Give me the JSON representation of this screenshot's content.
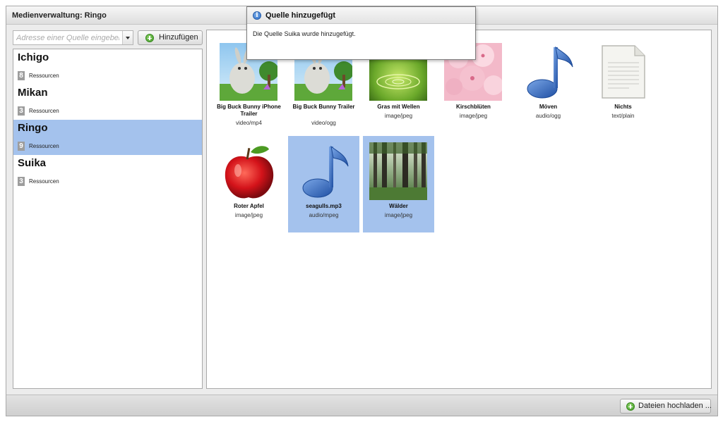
{
  "window": {
    "title": "Medienverwaltung: Ringo"
  },
  "source_input": {
    "placeholder": "Adresse einer Quelle eingeben",
    "value": ""
  },
  "add_button": {
    "label": "Hinzufügen"
  },
  "sources": [
    {
      "name": "Ichigo",
      "count": "8",
      "count_label": "Ressourcen",
      "selected": false
    },
    {
      "name": "Mikan",
      "count": "3",
      "count_label": "Ressourcen",
      "selected": false
    },
    {
      "name": "Ringo",
      "count": "9",
      "count_label": "Ressourcen",
      "selected": true
    },
    {
      "name": "Suika",
      "count": "3",
      "count_label": "Ressourcen",
      "selected": false
    }
  ],
  "media": [
    {
      "name": "Big Buck Bunny iPhone Trailer",
      "type": "video/mp4",
      "icon": "bunny-thumbnail",
      "selected": false
    },
    {
      "name": "Big Buck Bunny Trailer",
      "type": "video/ogg",
      "icon": "bunny-thumbnail",
      "selected": false
    },
    {
      "name": "Gras mit Wellen",
      "type": "image/jpeg",
      "icon": "grass-thumbnail",
      "selected": false
    },
    {
      "name": "Kirschblüten",
      "type": "image/jpeg",
      "icon": "blossom-thumbnail",
      "selected": false
    },
    {
      "name": "Möven",
      "type": "audio/ogg",
      "icon": "music-note-icon",
      "selected": false
    },
    {
      "name": "Nichts",
      "type": "text/plain",
      "icon": "document-icon",
      "selected": false
    },
    {
      "name": "Roter Apfel",
      "type": "image/jpeg",
      "icon": "apple-thumbnail",
      "selected": false
    },
    {
      "name": "seagulls.mp3",
      "type": "audio/mpeg",
      "icon": "music-note-icon",
      "selected": true
    },
    {
      "name": "Wälder",
      "type": "image/jpeg",
      "icon": "forest-thumbnail",
      "selected": true
    }
  ],
  "upload_button": {
    "label": "Dateien hochladen ..."
  },
  "notification": {
    "title": "Quelle hinzugefügt",
    "message": "Die Quelle Suika wurde hinzugefügt."
  },
  "colors": {
    "selection": "#a4c2ed",
    "accent_green": "#4aa52c",
    "info_blue": "#2c6cc7",
    "note_blue": "#2e5fb5"
  }
}
